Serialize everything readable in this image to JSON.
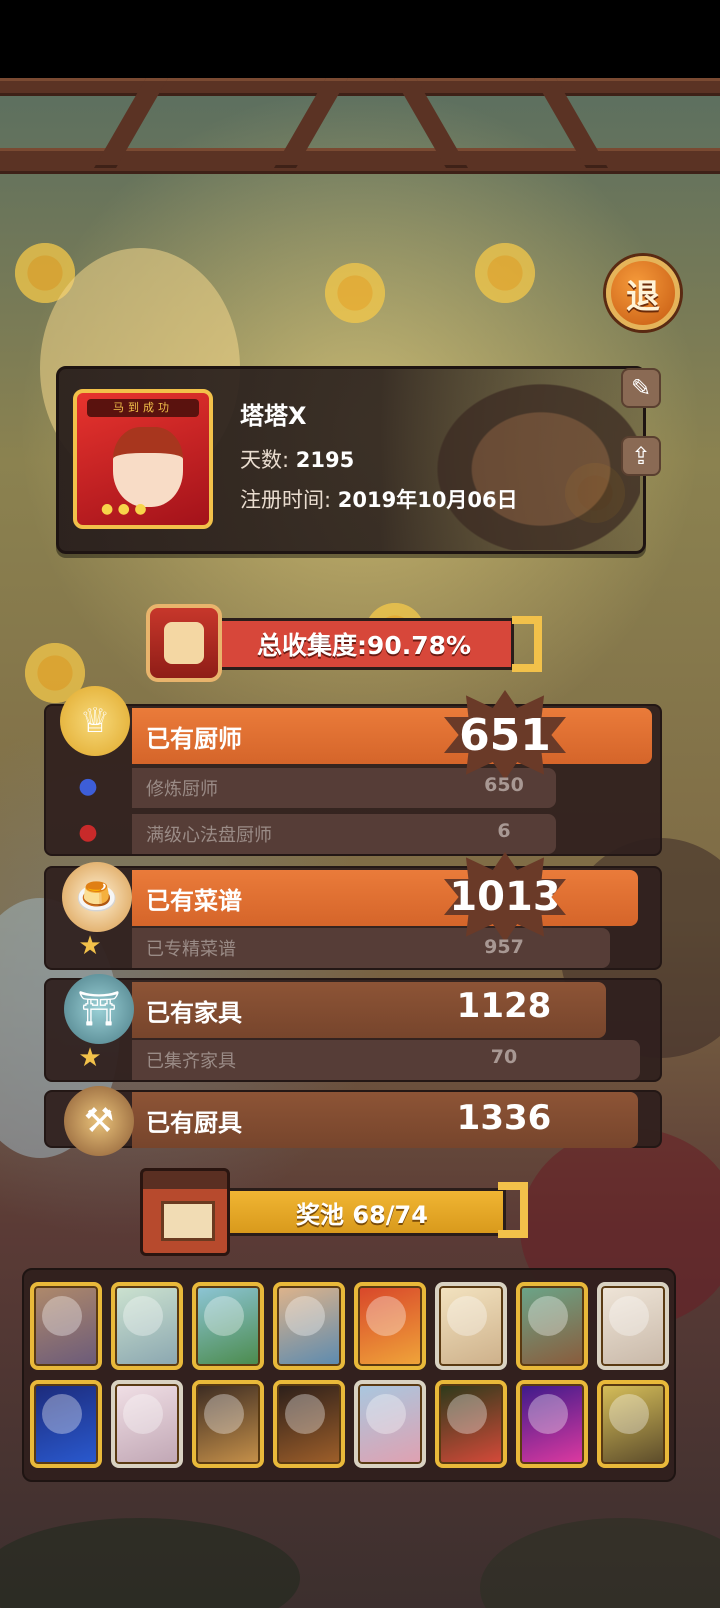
{
  "header": {
    "exit_label": "退"
  },
  "profile": {
    "name": "塔塔X",
    "days_label": "天数:",
    "days_value": "2195",
    "reg_label": "注册时间:",
    "reg_value": "2019年10月06日",
    "avatar_banner": "马到成功"
  },
  "total": {
    "label": "总收集度:90.78%"
  },
  "stats": {
    "chefs": {
      "label": "已有厨师",
      "value": "651",
      "sub": [
        {
          "label": "修炼厨师",
          "value": "650"
        },
        {
          "label": "满级心法盘厨师",
          "value": "6"
        }
      ]
    },
    "recipes": {
      "label": "已有菜谱",
      "value": "1013",
      "sub": [
        {
          "label": "已专精菜谱",
          "value": "957"
        }
      ]
    },
    "furniture": {
      "label": "已有家具",
      "value": "1128",
      "sub": [
        {
          "label": "已集齐家具",
          "value": "70"
        }
      ]
    },
    "tools": {
      "label": "已有厨具",
      "value": "1336"
    }
  },
  "pool": {
    "label": "奖池  68/74"
  },
  "colors": {
    "orange": "#ea7b3a",
    "brown": "#8d5436",
    "gold": "#f2c14a",
    "red": "#d7473a"
  },
  "icons": {
    "edit": "edit-icon",
    "share": "share-icon",
    "chef": "chef-hat-icon",
    "blue_person": "blue-person-icon",
    "red_person": "red-person-icon",
    "pudding": "pudding-icon",
    "star": "star-icon",
    "furniture": "furniture-icon",
    "tool": "kitchen-tool-icon",
    "pool": "pool-house-icon"
  }
}
